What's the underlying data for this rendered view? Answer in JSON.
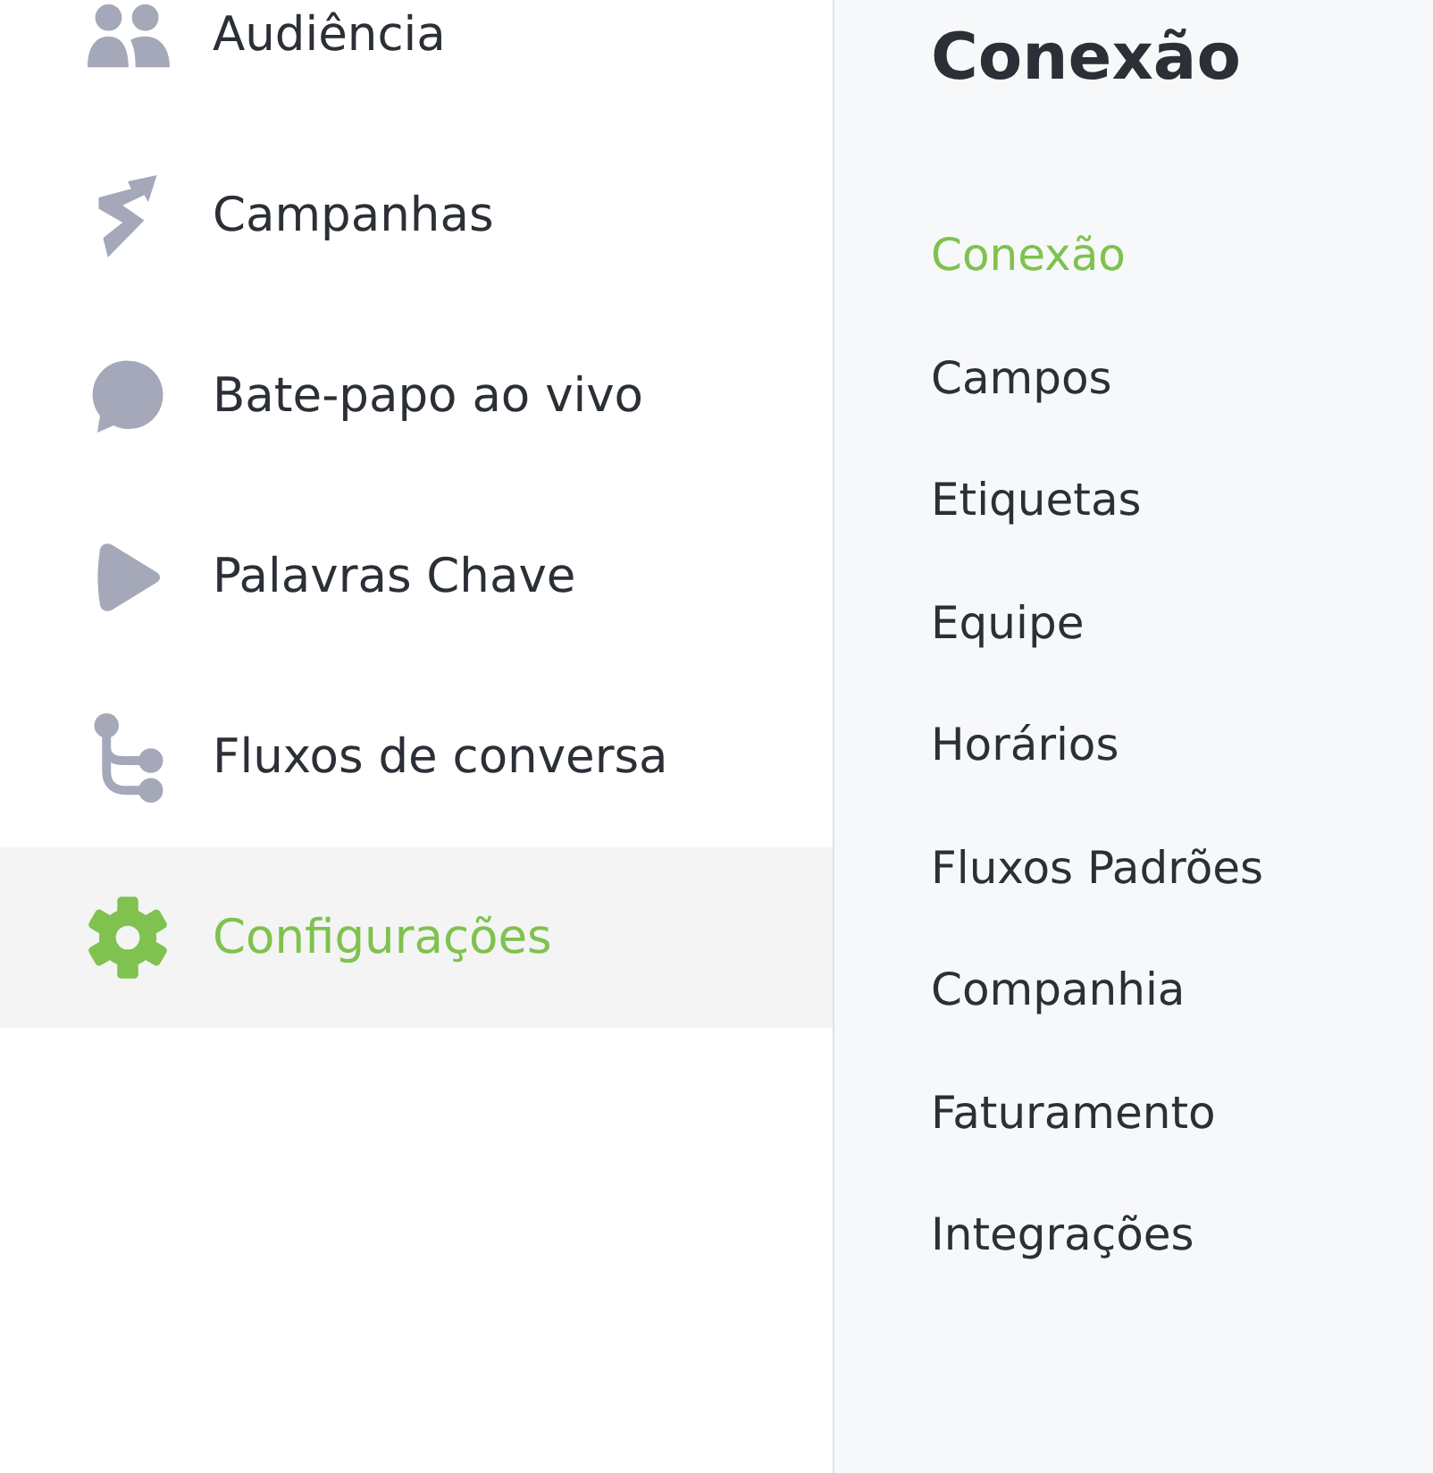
{
  "sidebar": {
    "items": [
      {
        "label": "Audiência",
        "kind": "audience",
        "selected": false
      },
      {
        "label": "Campanhas",
        "kind": "campaigns",
        "selected": false
      },
      {
        "label": "Bate-papo ao vivo",
        "kind": "chat",
        "selected": false
      },
      {
        "label": "Palavras Chave",
        "kind": "keywords",
        "selected": false
      },
      {
        "label": "Fluxos de conversa",
        "kind": "flows",
        "selected": false
      },
      {
        "label": "Configurações",
        "kind": "settings",
        "selected": true
      }
    ]
  },
  "settings_panel": {
    "title": "Conexão",
    "items": [
      {
        "label": "Conexão",
        "selected": true
      },
      {
        "label": "Campos",
        "selected": false
      },
      {
        "label": "Etiquetas",
        "selected": false
      },
      {
        "label": "Equipe",
        "selected": false
      },
      {
        "label": "Horários",
        "selected": false
      },
      {
        "label": "Fluxos Padrões",
        "selected": false
      },
      {
        "label": "Companhia",
        "selected": false
      },
      {
        "label": "Faturamento",
        "selected": false
      },
      {
        "label": "Integrações",
        "selected": false
      }
    ]
  }
}
